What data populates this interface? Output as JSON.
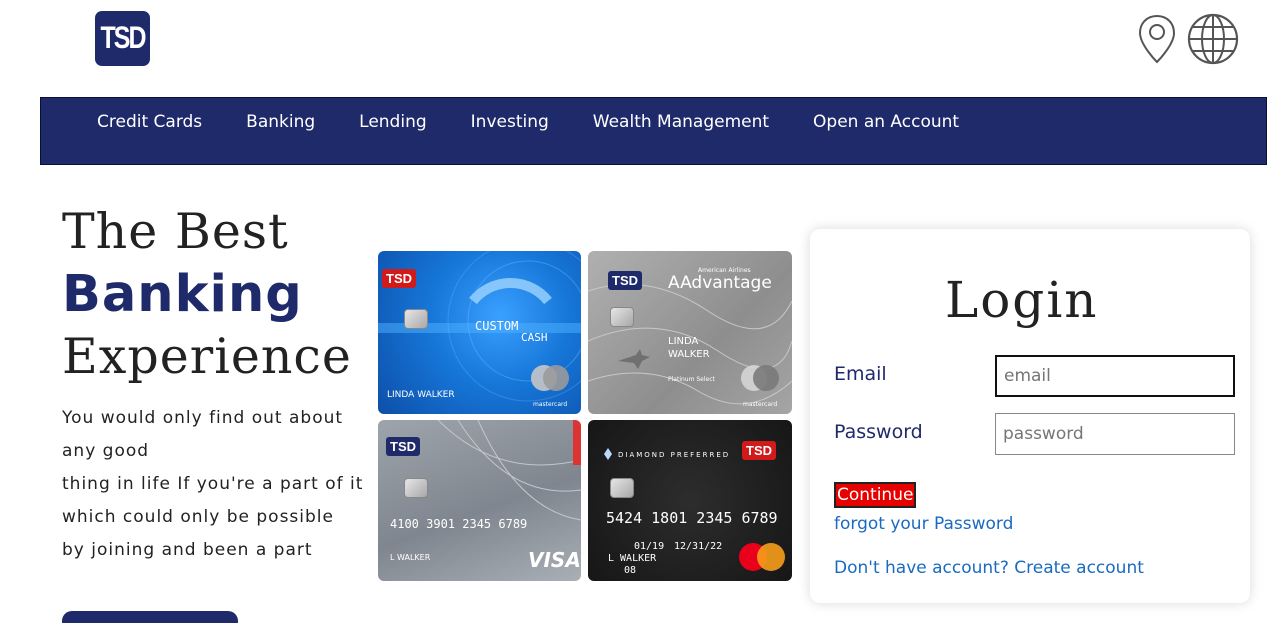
{
  "header": {
    "logo_text": "TSD",
    "icons": [
      "location-pin-icon",
      "globe-icon"
    ]
  },
  "nav": {
    "items": [
      {
        "label": "Credit Cards"
      },
      {
        "label": "Banking"
      },
      {
        "label": "Lending"
      },
      {
        "label": "Investing"
      },
      {
        "label": "Wealth Management"
      },
      {
        "label": "Open an Account"
      }
    ]
  },
  "hero": {
    "line1": "The Best",
    "line2": "Banking",
    "line3": "Experience",
    "description": [
      "You would only find out about",
      "any good",
      "thing in life If you're a part of it",
      "which could only be possible",
      "by joining and been a part"
    ]
  },
  "cards": [
    {
      "brand": "TSD",
      "name_text": "CUSTOM",
      "name_text2": "CASH",
      "holder": "LINDA WALKER",
      "network": "mastercard"
    },
    {
      "brand": "TSD",
      "program": "AAdvantage",
      "program_top": "American Airlines",
      "holder_line1": "LINDA",
      "holder_line2": "WALKER",
      "tier": "Platinum Select",
      "network": "mastercard"
    },
    {
      "brand": "TSD",
      "number": "4100 3901 2345 6789",
      "holder": "L WALKER",
      "network": "VISA"
    },
    {
      "brand": "TSD",
      "tier": "DIAMOND PREFERRED",
      "number": "5424 1801 2345 6789",
      "valid_from": "01/19",
      "expires": "12/31/22",
      "holder": "L WALKER",
      "code": "08"
    }
  ],
  "login": {
    "title": "Login",
    "email_label": "Email",
    "email_placeholder": "email",
    "password_label": "Password",
    "password_placeholder": "password",
    "continue_label": "Continue",
    "forgot_link": "forgot your Password",
    "create_link": "Don't have account? Create account"
  },
  "colors": {
    "brand_navy": "#1f2a6b",
    "accent_red": "#e60000",
    "link_blue": "#1a6ac2"
  }
}
